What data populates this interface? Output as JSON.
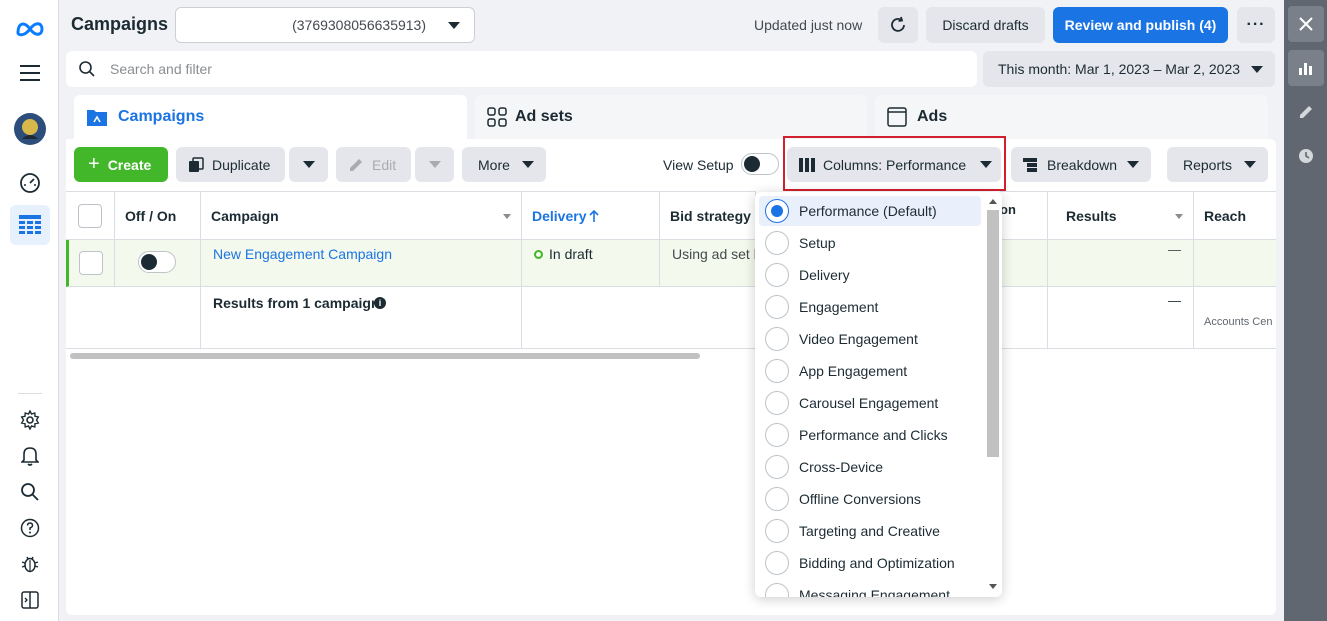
{
  "colors": {
    "accent": "#1b74e4",
    "create_green": "#42b72a",
    "draft_green": "#42b72a",
    "highlight_red": "#d0202f",
    "row_bg": "#f3f9ec"
  },
  "leftnav": {
    "items": [
      "meta-logo",
      "menu",
      "account-avatar",
      "dashboard",
      "campaigns-table"
    ],
    "bottom_items": [
      "settings",
      "notifications",
      "search",
      "help",
      "bug-report",
      "panel-toggle"
    ]
  },
  "header": {
    "title": "Campaigns",
    "account_id": "(3769308056635913)",
    "updated_text": "Updated just now",
    "discard_label": "Discard drafts",
    "review_label": "Review and publish (4)"
  },
  "search": {
    "placeholder": "Search and filter"
  },
  "daterange": {
    "label": "This month: Mar 1, 2023 – Mar 2, 2023"
  },
  "tabs": [
    {
      "label": "Campaigns",
      "active": true
    },
    {
      "label": "Ad sets",
      "active": false
    },
    {
      "label": "Ads",
      "active": false
    }
  ],
  "toolbar": {
    "create_label": "Create",
    "duplicate_label": "Duplicate",
    "edit_label": "Edit",
    "more_label": "More",
    "view_setup_label": "View Setup",
    "columns_label": "Columns: Performance",
    "breakdown_label": "Breakdown",
    "reports_label": "Reports"
  },
  "table": {
    "headers": {
      "offon": "Off / On",
      "campaign": "Campaign",
      "delivery": "Delivery",
      "bid_strategy": "Bid strategy",
      "attribution_partial": "on",
      "results": "Results",
      "reach": "Reach"
    },
    "rows": [
      {
        "campaign": "New Engagement Campaign",
        "delivery": "In draft",
        "bid_strategy": "Using ad set b",
        "results": "—"
      }
    ],
    "summary": {
      "label": "Results from 1 campaign",
      "results": "—",
      "reach_note": "Accounts Cen"
    }
  },
  "columns_menu": {
    "options": [
      {
        "label": "Performance (Default)",
        "selected": true
      },
      {
        "label": "Setup",
        "selected": false
      },
      {
        "label": "Delivery",
        "selected": false
      },
      {
        "label": "Engagement",
        "selected": false
      },
      {
        "label": "Video Engagement",
        "selected": false
      },
      {
        "label": "App Engagement",
        "selected": false
      },
      {
        "label": "Carousel Engagement",
        "selected": false
      },
      {
        "label": "Performance and Clicks",
        "selected": false
      },
      {
        "label": "Cross-Device",
        "selected": false
      },
      {
        "label": "Offline Conversions",
        "selected": false
      },
      {
        "label": "Targeting and Creative",
        "selected": false
      },
      {
        "label": "Bidding and Optimization",
        "selected": false
      },
      {
        "label": "Messaging Engagement",
        "selected": false
      }
    ]
  }
}
